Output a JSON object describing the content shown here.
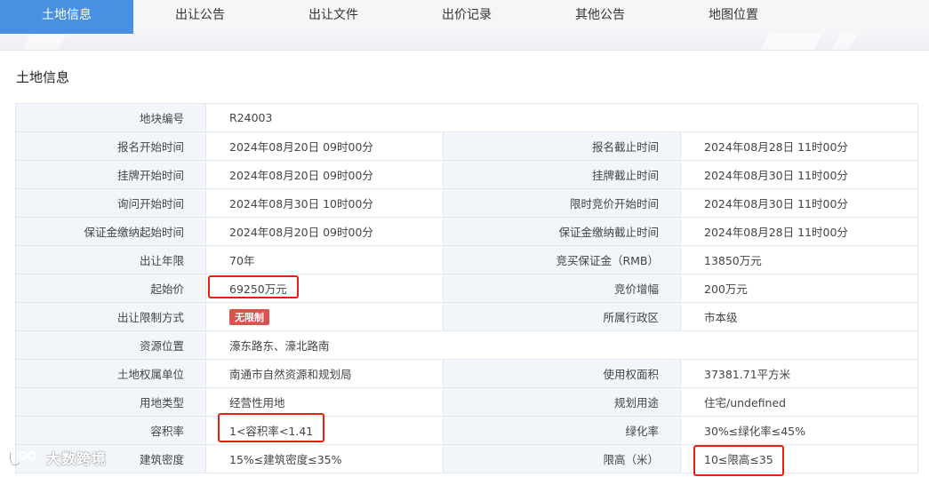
{
  "tabs": [
    {
      "label": "土地信息",
      "active": true
    },
    {
      "label": "出让公告"
    },
    {
      "label": "出让文件"
    },
    {
      "label": "出价记录"
    },
    {
      "label": "其他公告"
    },
    {
      "label": "地图位置"
    }
  ],
  "section_title": "土地信息",
  "fields": {
    "parcel_no": {
      "label": "地块编号",
      "value": "R24003"
    },
    "reg_start": {
      "label": "报名开始时间",
      "value": "2024年08月20日 09时00分"
    },
    "reg_end": {
      "label": "报名截止时间",
      "value": "2024年08月28日 11时00分"
    },
    "list_start": {
      "label": "挂牌开始时间",
      "value": "2024年08月20日 09时00分"
    },
    "list_end": {
      "label": "挂牌截止时间",
      "value": "2024年08月30日 11时00分"
    },
    "inquiry_start": {
      "label": "询问开始时间",
      "value": "2024年08月30日 10时00分"
    },
    "timed_bid_start": {
      "label": "限时竞价开始时间",
      "value": "2024年08月30日 11时00分"
    },
    "deposit_start": {
      "label": "保证金缴纳起始时间",
      "value": "2024年08月20日 09时00分"
    },
    "deposit_end": {
      "label": "保证金缴纳截止时间",
      "value": "2024年08月28日 11时00分"
    },
    "term": {
      "label": "出让年限",
      "value": "70年"
    },
    "bid_deposit": {
      "label": "竞买保证金（RMB）",
      "value": "13850万元"
    },
    "start_price": {
      "label": "起始价",
      "value": "69250万元"
    },
    "increment": {
      "label": "竞价增幅",
      "value": "200万元"
    },
    "restriction": {
      "label": "出让限制方式",
      "value": "无限制"
    },
    "district": {
      "label": "所属行政区",
      "value": "市本级"
    },
    "location": {
      "label": "资源位置",
      "value": "濠东路东、濠北路南"
    },
    "owner": {
      "label": "土地权属单位",
      "value": "南通市自然资源和规划局"
    },
    "area": {
      "label": "使用权面积",
      "value": "37381.71平方米"
    },
    "land_type": {
      "label": "用地类型",
      "value": "经营性用地"
    },
    "planned_use": {
      "label": "规划用途",
      "value": "住宅/undefined"
    },
    "far": {
      "label": "容积率",
      "value": "1<容积率<1.41"
    },
    "green": {
      "label": "绿化率",
      "value": "30%≤绿化率≤45%"
    },
    "density": {
      "label": "建筑密度",
      "value": "15%≤建筑密度≤35%"
    },
    "height": {
      "label": "限高（米）",
      "value": "10≤限高≤35"
    }
  },
  "watermark": "大数跨境",
  "colors": {
    "tab_active": "#4a90e2",
    "highlight_box": "#e8200b",
    "badge": "#d9534f",
    "label_bg": "#f2f6fb"
  }
}
